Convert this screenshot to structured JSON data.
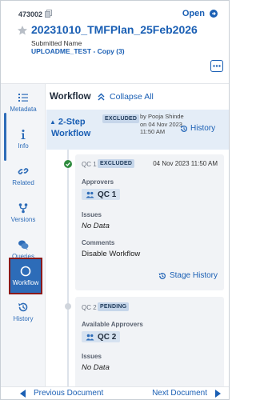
{
  "header": {
    "doc_id": "473002",
    "open_label": "Open",
    "title": "20231010_TMFPlan_25Feb2026",
    "submitted_label": "Submitted Name",
    "submitted_value": "UPLOADME_TEST - Copy (3)"
  },
  "rail": {
    "items": [
      {
        "label": "Metadata",
        "icon": "metadata-list-icon"
      },
      {
        "label": "Info",
        "icon": "info-icon"
      },
      {
        "label": "Related",
        "icon": "link-icon"
      },
      {
        "label": "Versions",
        "icon": "branch-icon"
      },
      {
        "label": "Queries",
        "icon": "chat-icon"
      },
      {
        "label": "Workflow",
        "icon": "circle-icon",
        "active": true
      },
      {
        "label": "History",
        "icon": "history-icon"
      }
    ]
  },
  "workflow": {
    "title": "Workflow",
    "collapse_label": "Collapse All",
    "step": {
      "name_line1": "2-Step",
      "name_line2": "Workflow",
      "badge": "EXCLUDED",
      "by_text": "by Pooja Shinde on 04 Nov 2023 11:50 AM",
      "history_label": "History"
    },
    "stages": [
      {
        "qc": "QC 1",
        "badge": "EXCLUDED",
        "date": "04 Nov 2023 11:50 AM",
        "approvers_label": "Approvers",
        "approver": "QC 1",
        "issues_label": "Issues",
        "issues_value": "No Data",
        "comments_label": "Comments",
        "comments_value": "Disable Workflow",
        "stage_history_label": "Stage History"
      },
      {
        "qc": "QC 2",
        "badge": "PENDING",
        "approvers_label": "Available Approvers",
        "approver": "QC 2",
        "issues_label": "Issues",
        "issues_value": "No Data"
      }
    ]
  },
  "footer": {
    "prev_label": "Previous Document",
    "next_label": "Next Document"
  },
  "colors": {
    "accent": "#1a5fb4",
    "rail_active": "#2d6cb8",
    "check": "#2e8b3e",
    "step_bg": "#e4edf7"
  }
}
